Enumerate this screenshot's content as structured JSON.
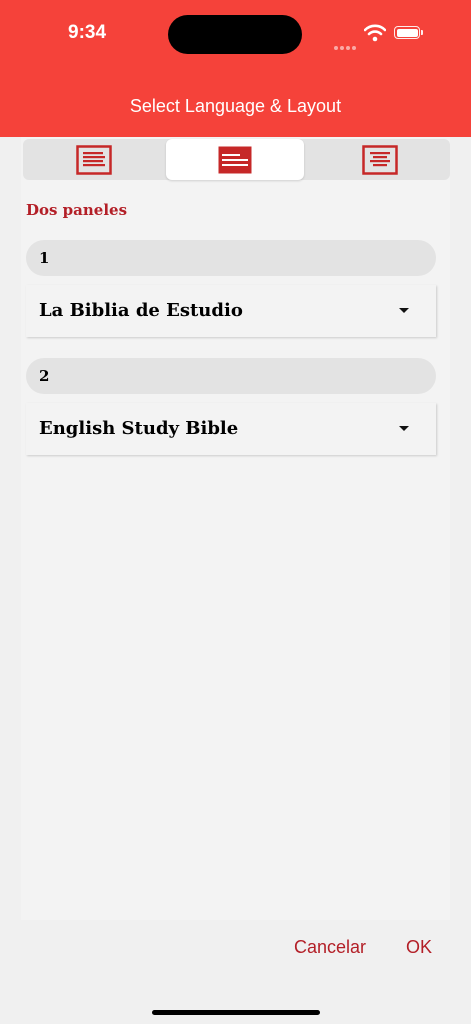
{
  "status_bar": {
    "time": "9:34"
  },
  "dialog": {
    "title": "Select Language & Layout"
  },
  "tabs": [
    {
      "icon": "single-pane-layout-icon",
      "active": false
    },
    {
      "icon": "two-pane-layout-icon",
      "active": true
    },
    {
      "icon": "centered-layout-icon",
      "active": false
    }
  ],
  "section_heading": "Dos paneles",
  "panes": [
    {
      "number": "1",
      "selected_bible": "La Biblia de Estudio"
    },
    {
      "number": "2",
      "selected_bible": "English Study Bible"
    }
  ],
  "actions": {
    "cancel": "Cancelar",
    "ok": "OK"
  },
  "colors": {
    "header": "#f5423a",
    "accent": "#b31f27",
    "icon": "#c62828"
  }
}
